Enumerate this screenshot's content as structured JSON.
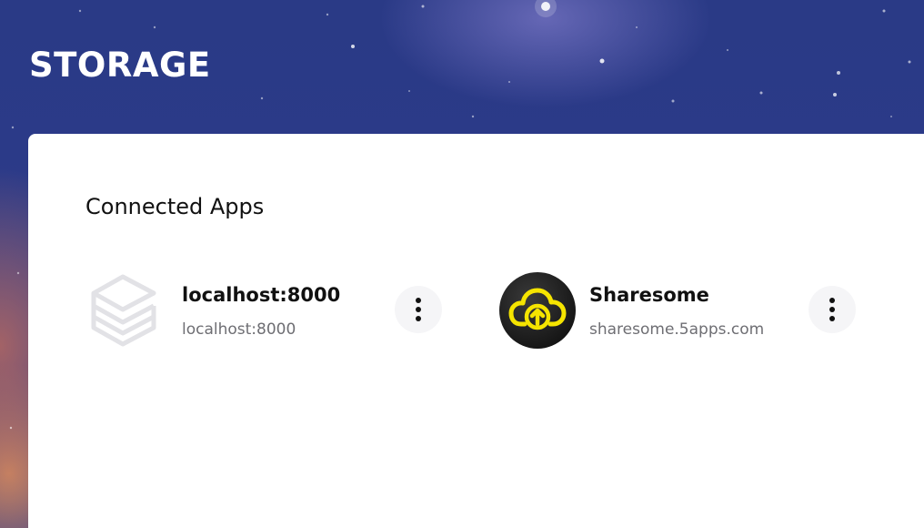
{
  "page": {
    "title": "STORAGE"
  },
  "section": {
    "title": "Connected Apps"
  },
  "apps": [
    {
      "name": "localhost:8000",
      "url": "localhost:8000",
      "icon": "stack-layers-icon",
      "menu_icon": "more-vertical-icon"
    },
    {
      "name": "Sharesome",
      "url": "sharesome.5apps.com",
      "icon": "cloud-upload-icon",
      "menu_icon": "more-vertical-icon"
    }
  ],
  "colors": {
    "background_top": "#2a3a86",
    "card": "#ffffff",
    "primary_text": "#111111",
    "secondary_text": "#6e6e73",
    "menu_button_bg": "#f5f5f7",
    "sharesome_accent": "#f5e400",
    "placeholder_icon": "#e2e2e6"
  }
}
